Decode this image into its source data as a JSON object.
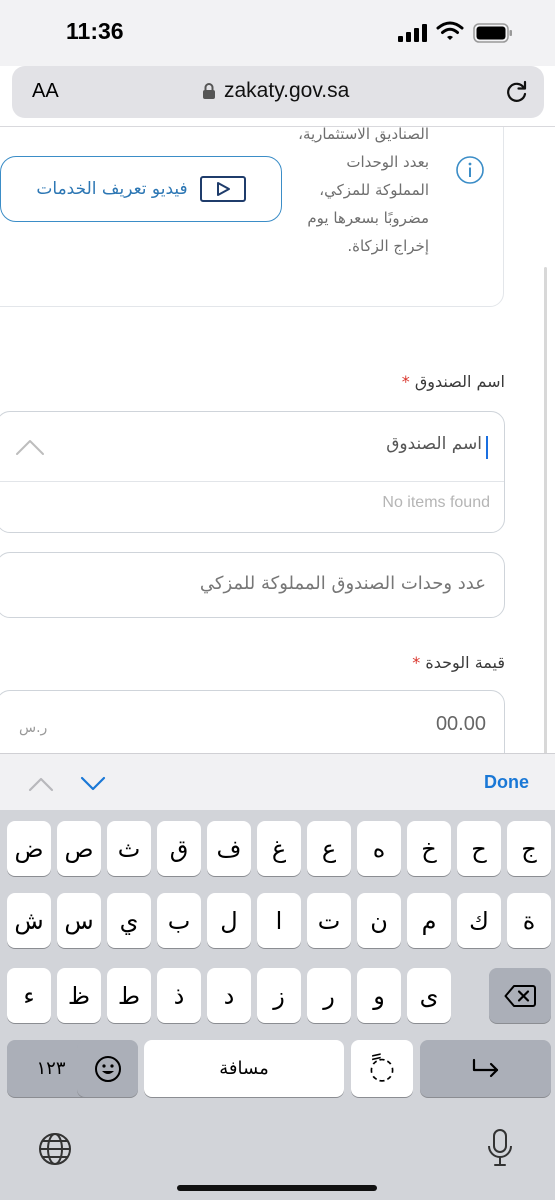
{
  "status_bar": {
    "time": "11:36"
  },
  "browser": {
    "text_size_label": "AA",
    "url": "zakaty.gov.sa"
  },
  "info_card": {
    "lines": [
      "الصناديق الاستثمارية،",
      "بعدد الوحدات",
      "المملوكة للمزكي،",
      "مضروبًا بسعرها يوم",
      "إخراج الزكاة."
    ],
    "video_button_label": "فيديو تعريف الخدمات"
  },
  "form": {
    "fund_name_label": "اسم الصندوق",
    "required_mark": "*",
    "fund_name_value": "اسم الصندوق",
    "no_items_text": "No items found",
    "units_placeholder": "عدد وحدات الصندوق المملوكة للمزكي",
    "unit_value_label": "قيمة الوحدة",
    "unit_value_placeholder": "00.00",
    "currency": "ر.س"
  },
  "accessory_bar": {
    "done_label": "Done"
  },
  "keyboard": {
    "row1": [
      "ض",
      "ص",
      "ث",
      "ق",
      "ف",
      "غ",
      "ع",
      "ه",
      "خ",
      "ح",
      "ج"
    ],
    "row2": [
      "ش",
      "س",
      "ي",
      "ب",
      "ل",
      "ا",
      "ت",
      "ن",
      "م",
      "ك",
      "ة"
    ],
    "row3": [
      "ء",
      "ظ",
      "ط",
      "ذ",
      "د",
      "ز",
      "ر",
      "و",
      "ى"
    ],
    "numbers_key": "١٢٣",
    "space_label": "مسافة",
    "diacritic_key": "ً"
  },
  "colors": {
    "accent": "#2d77b4",
    "required": "#d9342b",
    "done": "#1a78d6",
    "keyboard_bg": "#d2d4d9"
  }
}
